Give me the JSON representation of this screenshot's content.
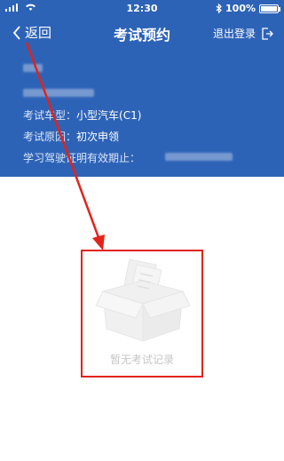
{
  "status": {
    "time": "12:30",
    "battery_text": "100%",
    "battery_level": 1.0
  },
  "nav": {
    "back": "返回",
    "title": "考试预约",
    "logout": "退出登录"
  },
  "info": {
    "car_type": {
      "label": "考试车型：",
      "value": "小型汽车(C1)"
    },
    "reason": {
      "label": "考试原因：",
      "value": "初次申领"
    },
    "validity": {
      "label": "学习驾驶证明有效期止：",
      "value": ""
    }
  },
  "empty": {
    "text": "暂无考试记录"
  },
  "colors": {
    "header": "#2d63b7",
    "annotation": "#e2231a"
  }
}
